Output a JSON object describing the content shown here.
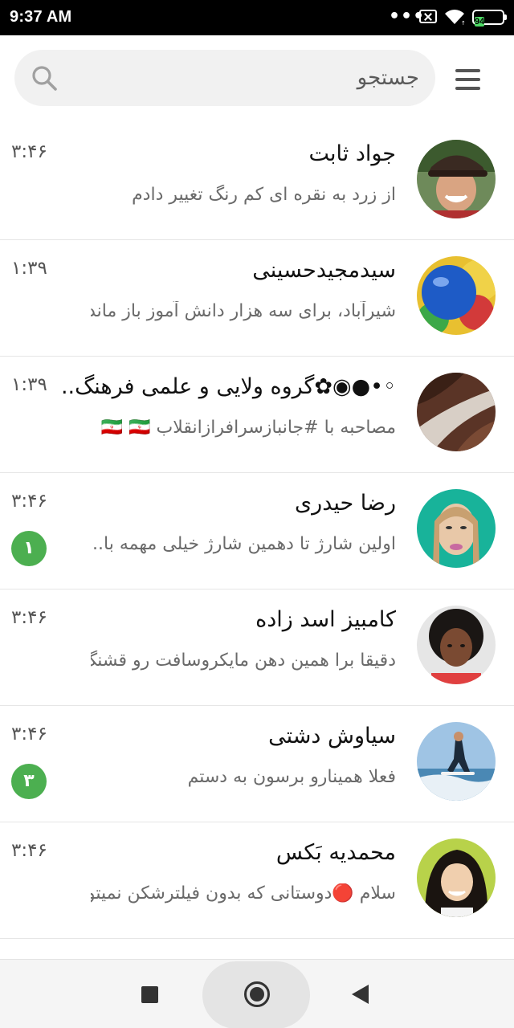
{
  "status_bar": {
    "time": "9:37 AM",
    "more": "•••",
    "battery": "94"
  },
  "search": {
    "placeholder": "جستجو"
  },
  "chats": [
    {
      "name": "جواد ثابت",
      "preview": "از زرد به نقره ای کم رنگ تغییر دادم",
      "time": "۳:۴۶",
      "badge": null
    },
    {
      "name": "سیدمجیدحسینی",
      "preview": "شیرآباد، برای سه هزار دانش آموز باز مانده از...",
      "time": "۱:۳۹",
      "badge": null
    },
    {
      "name": "◦•●◉✿گروه ولایی و علمی فرهنگ..",
      "preview": "مصاحبه با #جانبازسرافرازانقلاب 🇮🇷 🇮🇷 🌷...",
      "time": "۱:۳۹",
      "badge": null
    },
    {
      "name": "رضا حیدری",
      "preview": "اولین شارژ تا دهمین شارژ خیلی مهمه با...",
      "time": "۳:۴۶",
      "badge": "۱"
    },
    {
      "name": "کامبیز اسد زاده",
      "preview": "دقیقا برا همین دهن مایکروسافت رو قشنگ ...",
      "time": "۳:۴۶",
      "badge": null
    },
    {
      "name": "سیاوش دشتی",
      "preview": "فعلا همینارو برسون به دستم",
      "time": "۳:۴۶",
      "badge": "۳"
    },
    {
      "name": "محمدیه بَکس",
      "preview": "سلام 🔴دوستانی که بدون فیلترشکن نمیتون...",
      "time": "۳:۴۶",
      "badge": null
    }
  ]
}
